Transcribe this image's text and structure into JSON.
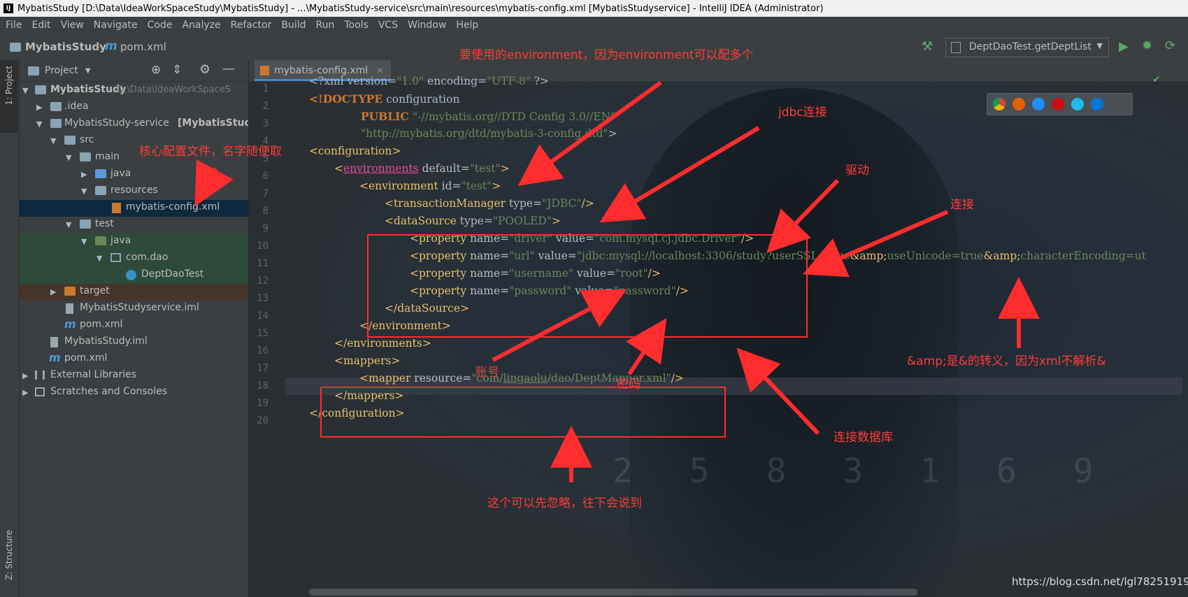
{
  "window": {
    "title": "MybatisStudy [D:\\Data\\IdeaWorkSpaceStudy\\MybatisStudy] - ...\\MybatisStudy-service\\src\\main\\resources\\mybatis-config.xml [MybatisStudyservice] - IntelliJ IDEA (Administrator)"
  },
  "menu": [
    "File",
    "Edit",
    "View",
    "Navigate",
    "Code",
    "Analyze",
    "Refactor",
    "Build",
    "Run",
    "Tools",
    "VCS",
    "Window",
    "Help"
  ],
  "breadcrumb": {
    "project": "MybatisStudy",
    "file_prefix": "m",
    "file": "pom.xml"
  },
  "run_config": "DeptDaoTest.getDeptList",
  "side_tabs": {
    "project": "1: Project",
    "structure": "Z: Structure"
  },
  "project_panel": {
    "title": "Project",
    "tree": [
      {
        "label": "MybatisStudy",
        "suffix": "D:\\Data\\IdeaWorkSpaceS",
        "bold": true
      },
      {
        "label": ".idea"
      },
      {
        "label": "MybatisStudy-service",
        "suffix": "[MybatisStudys",
        "suffix_bold": true
      },
      {
        "label": "src"
      },
      {
        "label": "main"
      },
      {
        "label": "java"
      },
      {
        "label": "resources"
      },
      {
        "label": "mybatis-config.xml"
      },
      {
        "label": "test"
      },
      {
        "label": "java"
      },
      {
        "label": "com.dao"
      },
      {
        "label": "DeptDaoTest"
      },
      {
        "label": "target"
      },
      {
        "label": "MybatisStudyservice.iml"
      },
      {
        "label": "pom.xml"
      },
      {
        "label": "MybatisStudy.iml"
      },
      {
        "label": "pom.xml"
      },
      {
        "label": "External Libraries"
      },
      {
        "label": "Scratches and Consoles"
      }
    ]
  },
  "editor": {
    "tab": "mybatis-config.xml",
    "line_numbers": [
      "1",
      "2",
      "3",
      "4",
      "5",
      "6",
      "7",
      "8",
      "9",
      "10",
      "11",
      "12",
      "13",
      "14",
      "15",
      "16",
      "17",
      "18",
      "19",
      "20"
    ]
  },
  "code": {
    "l1": {
      "a": "<?xml version=",
      "b": "\"1.0\"",
      "c": " encoding=",
      "d": "\"UTF-8\"",
      "e": " ?>"
    },
    "l2": {
      "a": "<!DOCTYPE",
      "b": " configuration"
    },
    "l3": {
      "a": "PUBLIC ",
      "b": "\"-//mybatis.org//DTD Config 3.0//EN\""
    },
    "l4": {
      "a": "\"http://mybatis.org/dtd/mybatis-3-config.dtd\"",
      "b": ">"
    },
    "l5": {
      "a": "<configuration>"
    },
    "l6": {
      "a": "<",
      "b": "environments",
      "c": " default=",
      "d": "\"test\"",
      "e": ">"
    },
    "l7": {
      "a": "<environment",
      "b": " id=",
      "c": "\"test\"",
      "d": ">"
    },
    "l8": {
      "a": "<transactionManager",
      "b": " type=",
      "c": "\"JDBC\"",
      "d": "/>"
    },
    "l9": {
      "a": "<dataSource",
      "b": " type=",
      "c": "\"POOLED\"",
      "d": ">"
    },
    "l10": {
      "a": "<property",
      "b": " name=",
      "c": "\"driver\"",
      "d": " value=",
      "e": "\"com.mysql.cj.jdbc.Driver\"",
      "f": "/>"
    },
    "l11": {
      "a": "<property",
      "b": " name=",
      "c": "\"url\"",
      "d": " value=",
      "e": "\"jdbc:mysql://localhost:3306/study?userSSL=true",
      "f": "&amp;",
      "g": "useUnicode=true",
      "h": "&amp;",
      "i": "characterEncoding=ut"
    },
    "l12": {
      "a": "<property",
      "b": " name=",
      "c": "\"username\"",
      "d": " value=",
      "e": "\"root\"",
      "f": "/>"
    },
    "l13": {
      "a": "<property",
      "b": " name=",
      "c": "\"password\"",
      "d": " value=",
      "e": "\"password\"",
      "f": "/>"
    },
    "l14": {
      "a": "</dataSource>"
    },
    "l15": {
      "a": "</environment>"
    },
    "l16": {
      "a": "</environments>"
    },
    "l17": {
      "a": "<mappers>"
    },
    "l18": {
      "a": "<mapper",
      "b": " resource=",
      "c": "\"com/",
      "d": "lingaolu",
      "e": "/dao/DeptMapper.xml\"",
      "f": "/>"
    },
    "l19": {
      "a": "</",
      "b": "mappers",
      "c": ">"
    },
    "l20": {
      "a": "</configuration>"
    }
  },
  "annotations": {
    "env": "要使用的environment，因为environment可以配多个",
    "jdbc": "jdbc连接",
    "core": "核心配置文件，名字随便取",
    "driver": "驱动",
    "conn": "连接",
    "account": "账号",
    "pwd": "密码",
    "amp": "&amp;是&的转义，因为xml不解析&",
    "db": "连接数据库",
    "ignore": "这个可以先忽略，往下会说到"
  },
  "watermark": "https://blog.csdn.net/lgl782519197",
  "colors": {
    "annotation": "#ff3b3b",
    "tag": "#e8bf6a",
    "string": "#6a8759",
    "keyword": "#cc7832"
  }
}
